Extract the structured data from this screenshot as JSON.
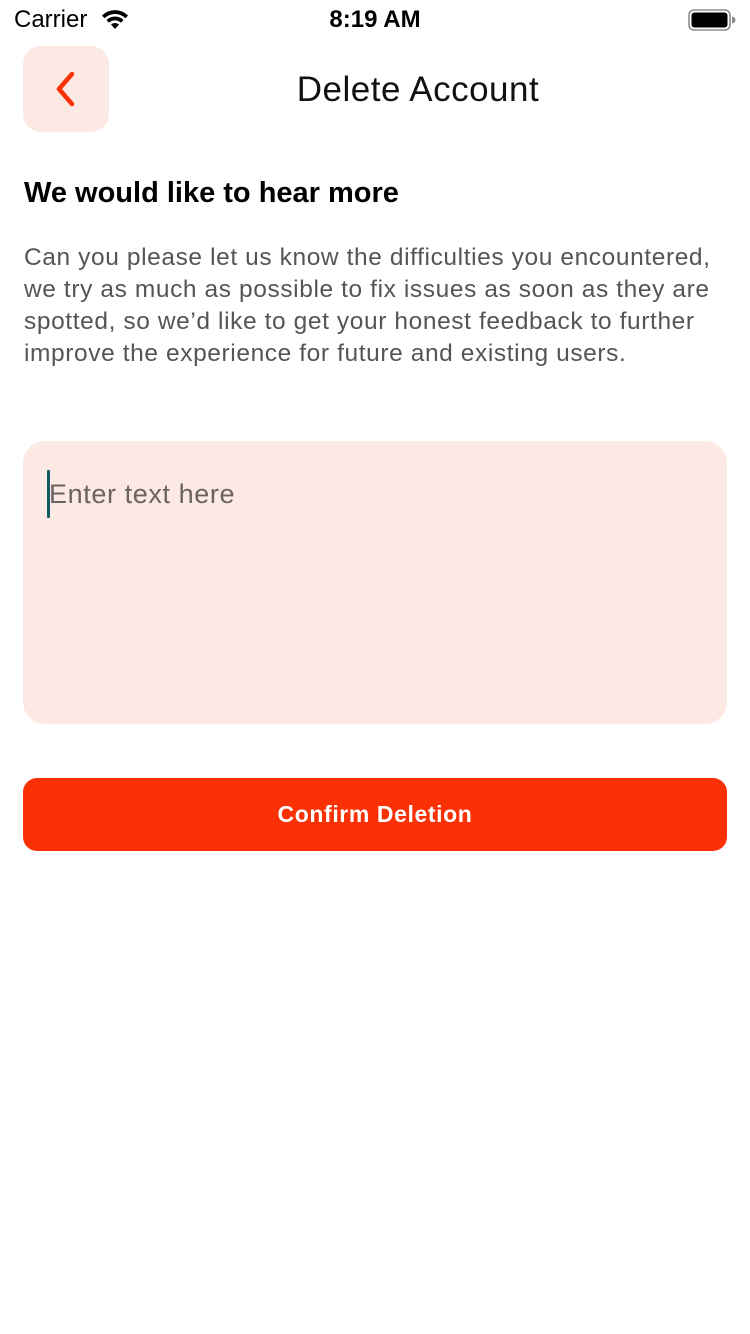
{
  "status_bar": {
    "carrier": "Carrier",
    "time": "8:19 AM",
    "icons": [
      "wifi-icon",
      "battery-icon"
    ]
  },
  "header": {
    "back_icon": "chevron-left-icon",
    "title": "Delete Account"
  },
  "content": {
    "heading": "We would like to hear more",
    "description": "Can you please let us know the difficulties you encountered, we try as much as possible to fix issues as soon as they are spotted, so we’d like to get your honest feedback to further improve the experience for future and existing users.",
    "feedback": {
      "placeholder": "Enter text here",
      "value": ""
    },
    "confirm_label": "Confirm Deletion"
  },
  "colors": {
    "accent": "#f93105",
    "accent_light": "#fce9e3",
    "caret": "#0e5b66",
    "body_text": "#555555"
  }
}
